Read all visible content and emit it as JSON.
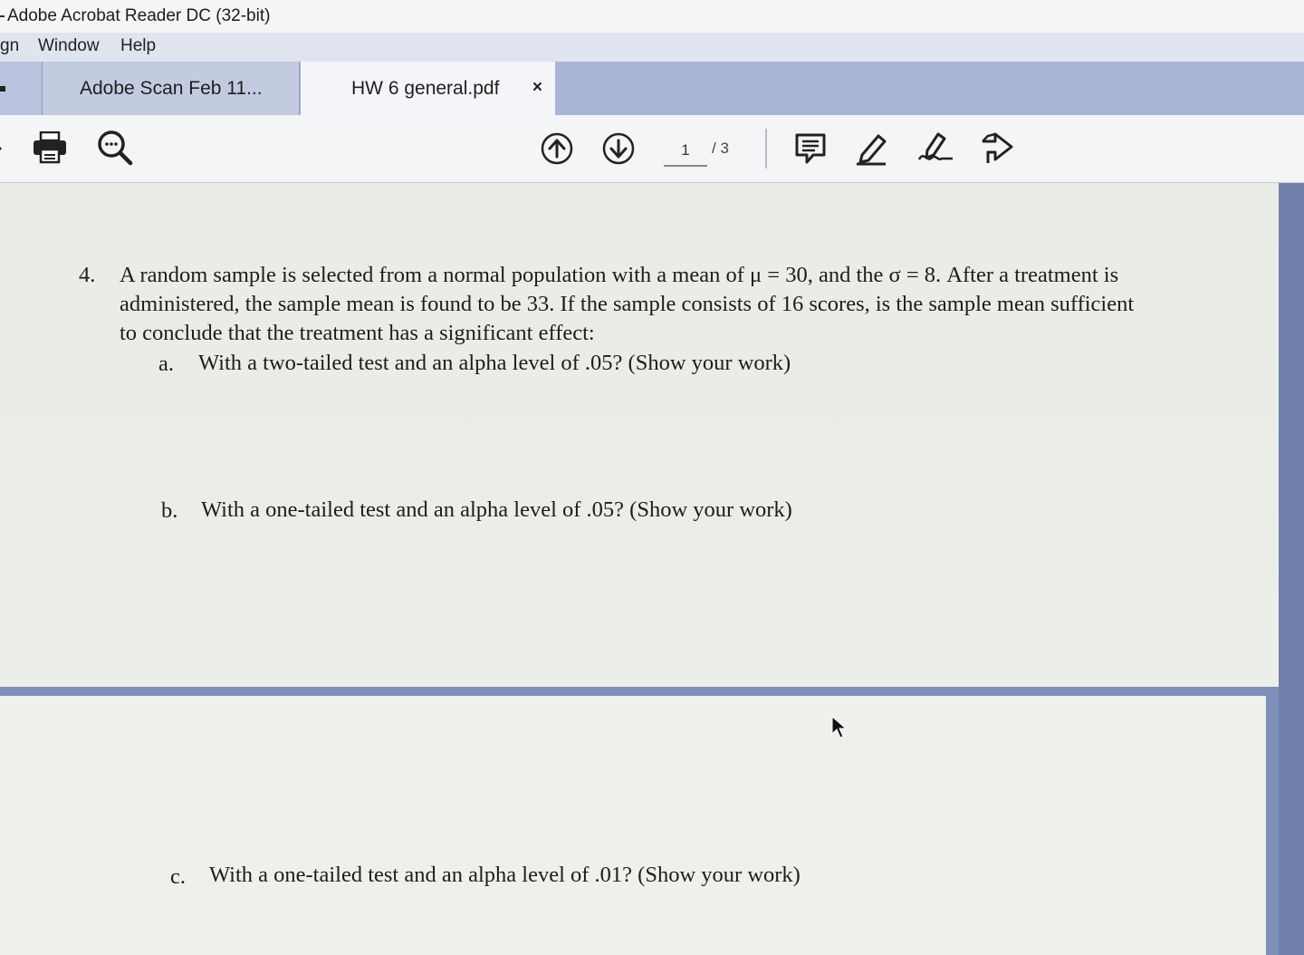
{
  "app": {
    "title": "Adobe Acrobat Reader DC (32-bit)"
  },
  "menu": {
    "items": [
      "gn",
      "Window",
      "Help"
    ]
  },
  "tabs": [
    {
      "label": "Adobe Scan Feb 11..."
    },
    {
      "label": "HW 6 general.pdf",
      "close": "×"
    }
  ],
  "toolbar": {
    "icons": [
      "print-icon",
      "search-icon",
      "page-up-icon",
      "page-down-icon",
      "comment-icon",
      "highlight-icon",
      "sign-icon",
      "share-icon"
    ],
    "page_current": "1",
    "page_total": "/ 3"
  },
  "document": {
    "question_number": "4.",
    "question_lines": [
      "A random sample is selected from a normal population with a mean of μ = 30, and the σ = 8.  After a treatment is",
      "administered, the sample mean is found to be 33. If the sample consists of 16 scores, is the sample mean sufficient",
      "to conclude that the treatment has a significant effect:"
    ],
    "parts": [
      {
        "label": "a.",
        "text": "With a two-tailed test and an alpha level of .05? (Show your work)"
      },
      {
        "label": "b.",
        "text": "With a one-tailed test and an alpha level of .05? (Show your work)"
      },
      {
        "label": "c.",
        "text": "With a one-tailed test and an alpha level of .01? (Show your work)"
      }
    ]
  }
}
